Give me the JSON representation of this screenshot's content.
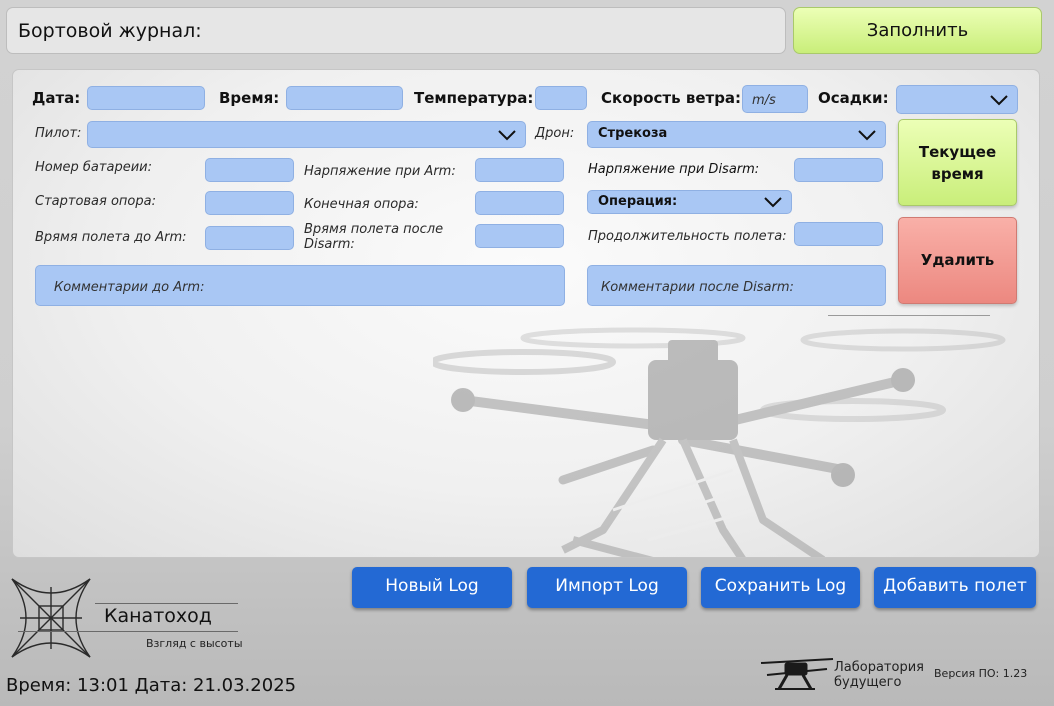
{
  "header": {
    "title": "Бортовой журнал:",
    "fill_button": "Заполнить"
  },
  "form": {
    "date_label": "Дата:",
    "time_label": "Время:",
    "temperature_label": "Температура:",
    "wind_label": "Скорость ветра:",
    "wind_placeholder": "m/s",
    "precip_label": "Осадки:",
    "pilot_label": "Пилот:",
    "drone_label": "Дрон:",
    "drone_value": "Стрекоза",
    "battery_label": "Номер батареии:",
    "voltage_arm_label": "Нарпяжение при Arm:",
    "voltage_disarm_label": "Нарпяжение при  Disarm:",
    "start_support_label": "Стартовая опора:",
    "end_support_label": "Конечная опора:",
    "operation_value": "Операция:",
    "flight_time_arm_label": "Врямя полета до Arm:",
    "flight_time_disarm_label_1": "Врямя полета после",
    "flight_time_disarm_label_2": "Disarm:",
    "duration_label": "Продолжительность полета:",
    "comment_arm_placeholder": "Комментарии до Arm:",
    "comment_disarm_placeholder": "Комментарии после Disarm:"
  },
  "side_buttons": {
    "current_time_line1": "Текущее",
    "current_time_line2": "время",
    "delete": "Удалить"
  },
  "bottom_buttons": {
    "new_log": "Новый Log",
    "import_log": "Импорт Log",
    "save_log": "Сохранить Log",
    "add_flight": "Добавить полет"
  },
  "branding": {
    "name": "Канатоход",
    "slogan": "Взгляд с высоты",
    "lab_line1": "Лаборатория",
    "lab_line2": "будущего",
    "version": "Версия ПО: 1.23"
  },
  "status": {
    "datetime": "Время: 13:01 Дата: 21.03.2025"
  },
  "colors": {
    "accent_green": "#c9ee7a",
    "accent_red": "#ec8880",
    "field_blue": "#a9c7f4",
    "button_blue": "#2369d4"
  }
}
